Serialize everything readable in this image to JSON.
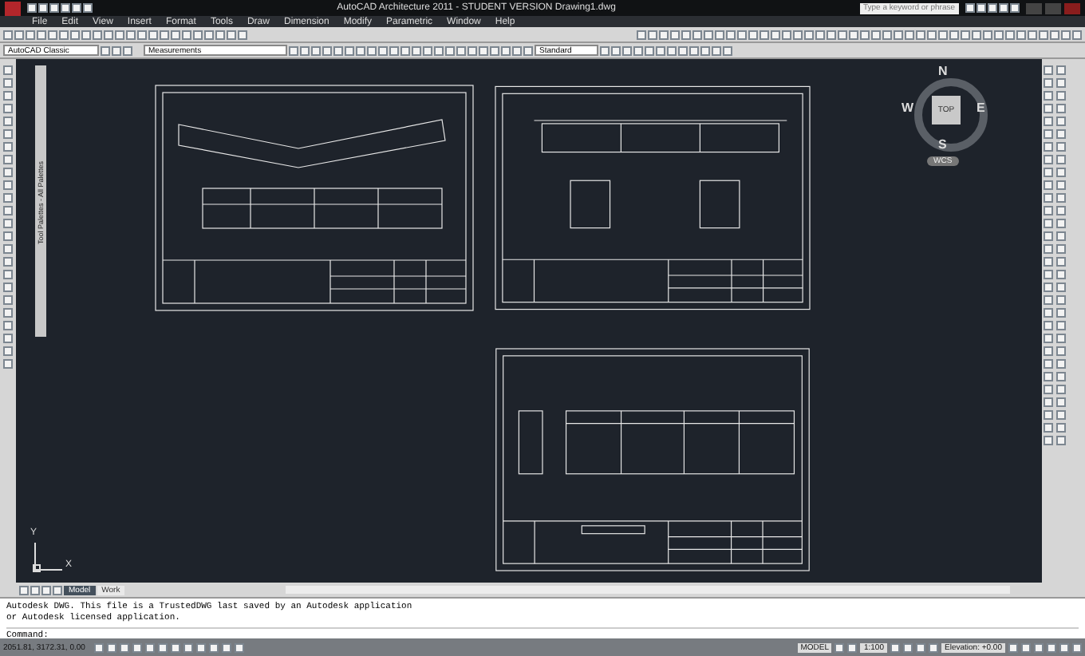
{
  "window": {
    "title": "AutoCAD Architecture 2011 - STUDENT VERSION    Drawing1.dwg"
  },
  "search": {
    "placeholder": "Type a keyword or phrase"
  },
  "menu": [
    "File",
    "Edit",
    "View",
    "Insert",
    "Format",
    "Tools",
    "Draw",
    "Dimension",
    "Modify",
    "Parametric",
    "Window",
    "Help"
  ],
  "toolbars": {
    "workspace": "AutoCAD Classic",
    "layer": "Measurements",
    "text_style": "Standard"
  },
  "tool_palette": {
    "label": "Tool Palettes - All Palettes"
  },
  "viewcube": {
    "face": "TOP",
    "north": "N",
    "south": "S",
    "east": "E",
    "west": "W",
    "ucs": "WCS"
  },
  "ucs_icon": {
    "x": "X",
    "y": "Y"
  },
  "layout_tabs": [
    {
      "label": "Model",
      "selected": true
    },
    {
      "label": "Work",
      "selected": false
    }
  ],
  "command_history": [
    "Autodesk DWG.  This file is a TrustedDWG last saved by an Autodesk application",
    "or Autodesk licensed application."
  ],
  "command_prompt": "Command:",
  "status_bar": {
    "coordinates": "2051.81, 3172.31, 0.00",
    "space": "MODEL",
    "scale": "1:100",
    "elevation": "Elevation: +0.00"
  }
}
